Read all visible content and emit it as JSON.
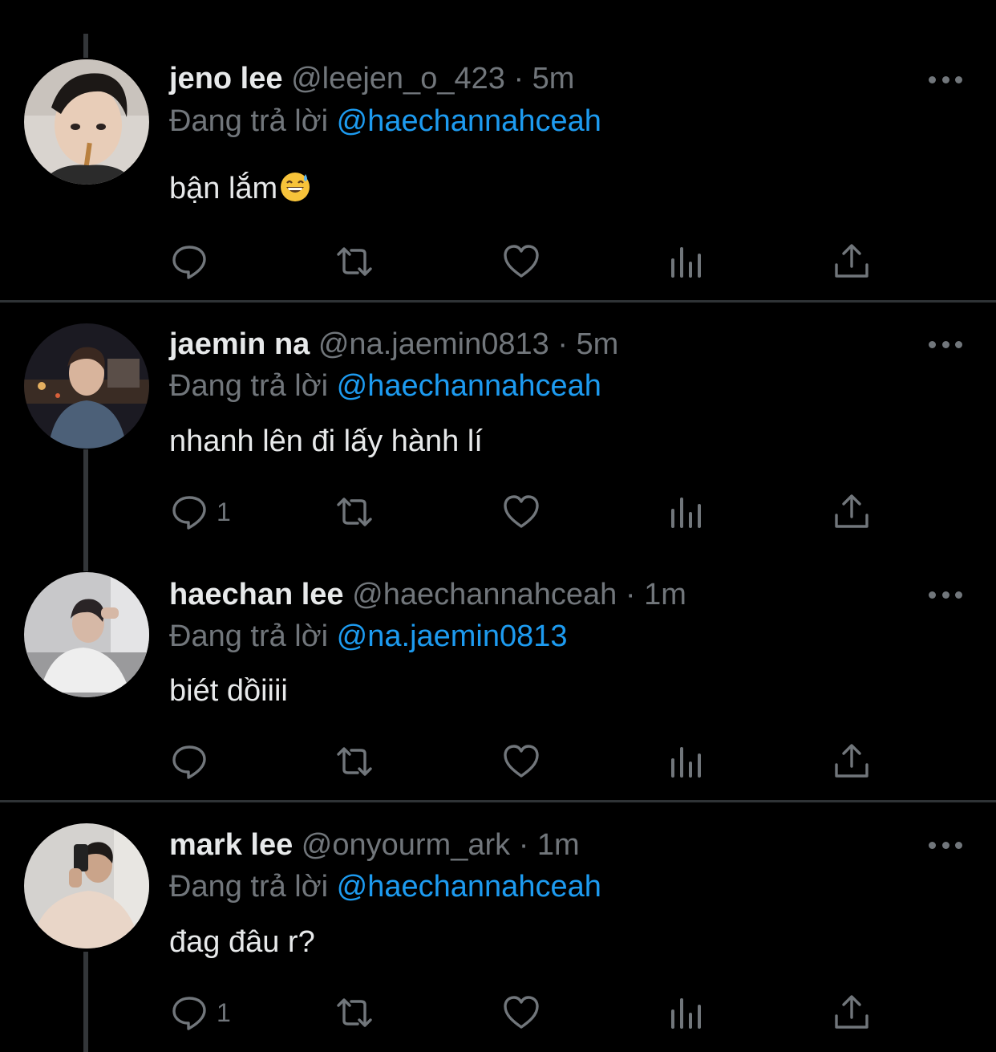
{
  "colors": {
    "background": "#000000",
    "text": "#e7e9ea",
    "muted": "#71767b",
    "mention": "#1d9bf0",
    "divider": "#2f3336",
    "thread_line": "#333639"
  },
  "tweets": [
    {
      "name": "jeno lee",
      "handle": "@leejen_o_423",
      "separator": "·",
      "time": "5m",
      "replying_label": "Đang trả lời",
      "replying_to": "@haechannahceah",
      "text": "bận lắm",
      "emoji_icon": "grinning-sweat-emoji-icon",
      "reply_count": "",
      "avatar_icon": "avatar-photo"
    },
    {
      "name": "jaemin na",
      "handle": "@na.jaemin0813",
      "separator": "·",
      "time": "5m",
      "replying_label": "Đang trả lời",
      "replying_to": "@haechannahceah",
      "text": "nhanh lên đi lấy hành lí",
      "reply_count": "1",
      "avatar_icon": "avatar-photo"
    },
    {
      "name": "haechan lee",
      "handle": "@haechannahceah",
      "separator": "·",
      "time": "1m",
      "replying_label": "Đang trả lời",
      "replying_to": "@na.jaemin0813",
      "text": "biét dồiiii",
      "reply_count": "",
      "avatar_icon": "avatar-photo"
    },
    {
      "name": "mark lee",
      "handle": "@onyourm_ark",
      "separator": "·",
      "time": "1m",
      "replying_label": "Đang trả lời",
      "replying_to": "@haechannahceah",
      "text": "đag đâu r?",
      "reply_count": "1",
      "avatar_icon": "avatar-photo"
    }
  ],
  "action_icons": [
    "reply-icon",
    "retweet-icon",
    "like-icon",
    "analytics-icon",
    "share-icon"
  ]
}
